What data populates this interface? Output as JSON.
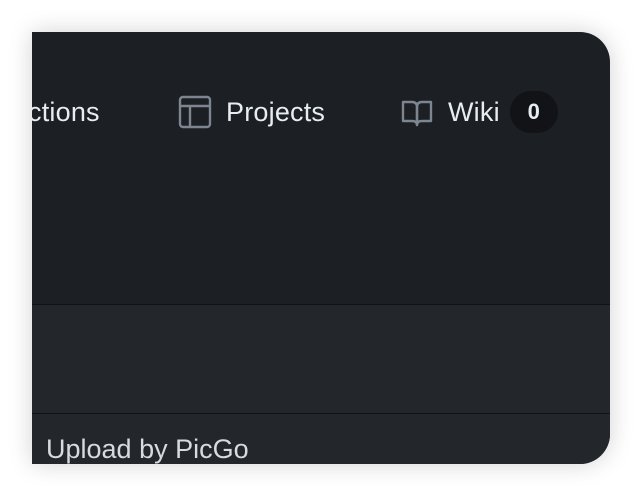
{
  "tabs": {
    "actions_label": "ctions",
    "projects_label": "Projects",
    "wiki_label": "Wiki",
    "wiki_count": "0"
  },
  "commit": {
    "message": "Upload by PicGo"
  },
  "colors": {
    "background": "#1c1f23",
    "band": "#23262b",
    "text": "#e6edf3",
    "icon": "#7d8590",
    "counter_bg": "#111316"
  },
  "icons": {
    "projects": "table-icon",
    "wiki": "book-icon"
  }
}
